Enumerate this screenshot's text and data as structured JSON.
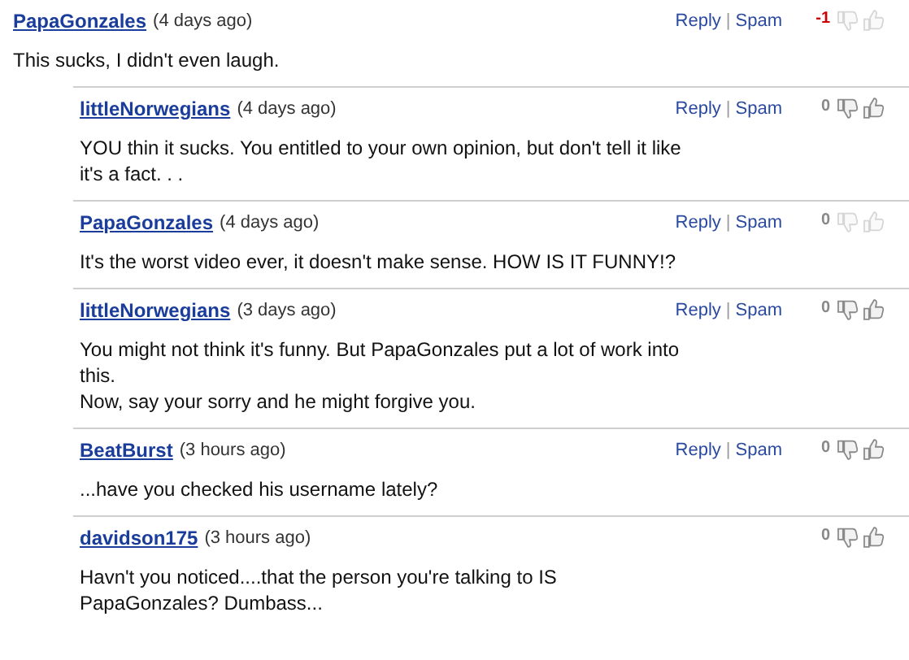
{
  "comments": [
    {
      "user": "PapaGonzales",
      "time": "(4 days ago)",
      "reply": "Reply",
      "separator": "|",
      "spam": "Spam",
      "score": "-1",
      "color": "#cc0000",
      "votes_disabled": true,
      "lines": [
        "This sucks, I didn't even laugh."
      ],
      "replies": [
        {
          "user": "littleNorwegians",
          "time": "(4 days ago)",
          "reply": "Reply",
          "separator": "|",
          "spam": "Spam",
          "score": "0",
          "color": "#888888",
          "votes_disabled": false,
          "lines": [
            "YOU thin it sucks. You entitled to your own opinion, but don't tell it like",
            "it's a fact. . ."
          ]
        },
        {
          "user": "PapaGonzales",
          "time": "(4 days ago)",
          "reply": "Reply",
          "separator": "|",
          "spam": "Spam",
          "score": "0",
          "color": "#888888",
          "votes_disabled": true,
          "lines": [
            "It's the worst video ever, it doesn't make sense. HOW IS IT FUNNY!?"
          ]
        },
        {
          "user": "littleNorwegians",
          "time": "(3 days ago)",
          "reply": "Reply",
          "separator": "|",
          "spam": "Spam",
          "score": "0",
          "color": "#888888",
          "votes_disabled": false,
          "lines": [
            "You might not think it's funny. But PapaGonzales put a lot of work into",
            "this.",
            "Now, say your sorry and he might forgive you."
          ]
        },
        {
          "user": "BeatBurst",
          "time": "(3 hours ago)",
          "reply": "Reply",
          "separator": "|",
          "spam": "Spam",
          "score": "0",
          "color": "#888888",
          "votes_disabled": false,
          "lines": [
            "...have you checked his username lately?"
          ]
        },
        {
          "user": "davidson175",
          "time": "(3 hours ago)",
          "score": "0",
          "color": "#888888",
          "votes_disabled": false,
          "lines": [
            "Havn't you noticed....that the person you're talking to IS",
            "PapaGonzales? Dumbass..."
          ]
        }
      ]
    }
  ]
}
